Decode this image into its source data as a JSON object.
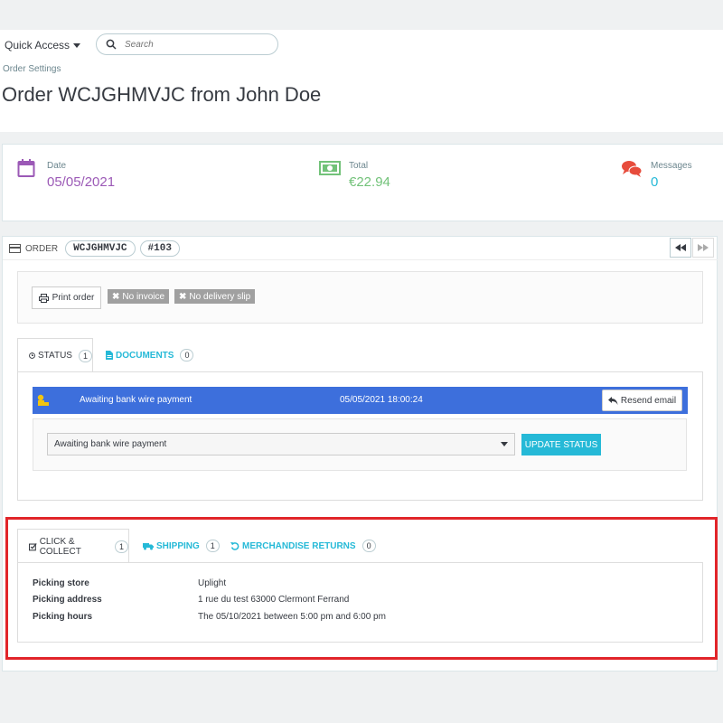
{
  "header": {
    "quick_access": "Quick Access",
    "search_placeholder": "Search",
    "breadcrumb": "Order Settings",
    "title": "Order WCJGHMVJC from John Doe"
  },
  "kpis": [
    {
      "label": "Date",
      "value": "05/05/2021",
      "icon": "calendar-icon",
      "color": "#9b59b6"
    },
    {
      "label": "Total",
      "value": "€22.94",
      "icon": "money-icon",
      "color": "#72c279"
    },
    {
      "label": "Messages",
      "value": "0",
      "icon": "chat-bubbles-icon",
      "color": "#25b9d7"
    }
  ],
  "order": {
    "label": "ORDER",
    "reference": "WCJGHMVJC",
    "id": "#103",
    "print_label": "Print order",
    "no_invoice": "No invoice",
    "no_delivery_slip": "No delivery slip"
  },
  "status_tabs": [
    {
      "label": "STATUS",
      "count": "1"
    },
    {
      "label": "DOCUMENTS",
      "count": "0"
    }
  ],
  "status_row": {
    "label": "Awaiting bank wire payment",
    "date": "05/05/2021 18:00:24",
    "resend": "Resend email",
    "color": "#3d6fdc"
  },
  "update": {
    "selected": "Awaiting bank wire payment",
    "button": "UPDATE STATUS"
  },
  "bottom_tabs": [
    {
      "label": "CLICK & COLLECT",
      "count": "1"
    },
    {
      "label": "SHIPPING",
      "count": "1"
    },
    {
      "label": "MERCHANDISE RETURNS",
      "count": "0"
    }
  ],
  "click_collect": {
    "store_label": "Picking store",
    "store_value": "Uplight",
    "address_label": "Picking address",
    "address_value": "1 rue du test 63000 Clermont Ferrand",
    "hours_label": "Picking hours",
    "hours_value": "The 05/10/2021 between 5:00 pm and 6:00 pm"
  },
  "colors": {
    "accent": "#25b9d7",
    "highlight": "#e1252a"
  }
}
